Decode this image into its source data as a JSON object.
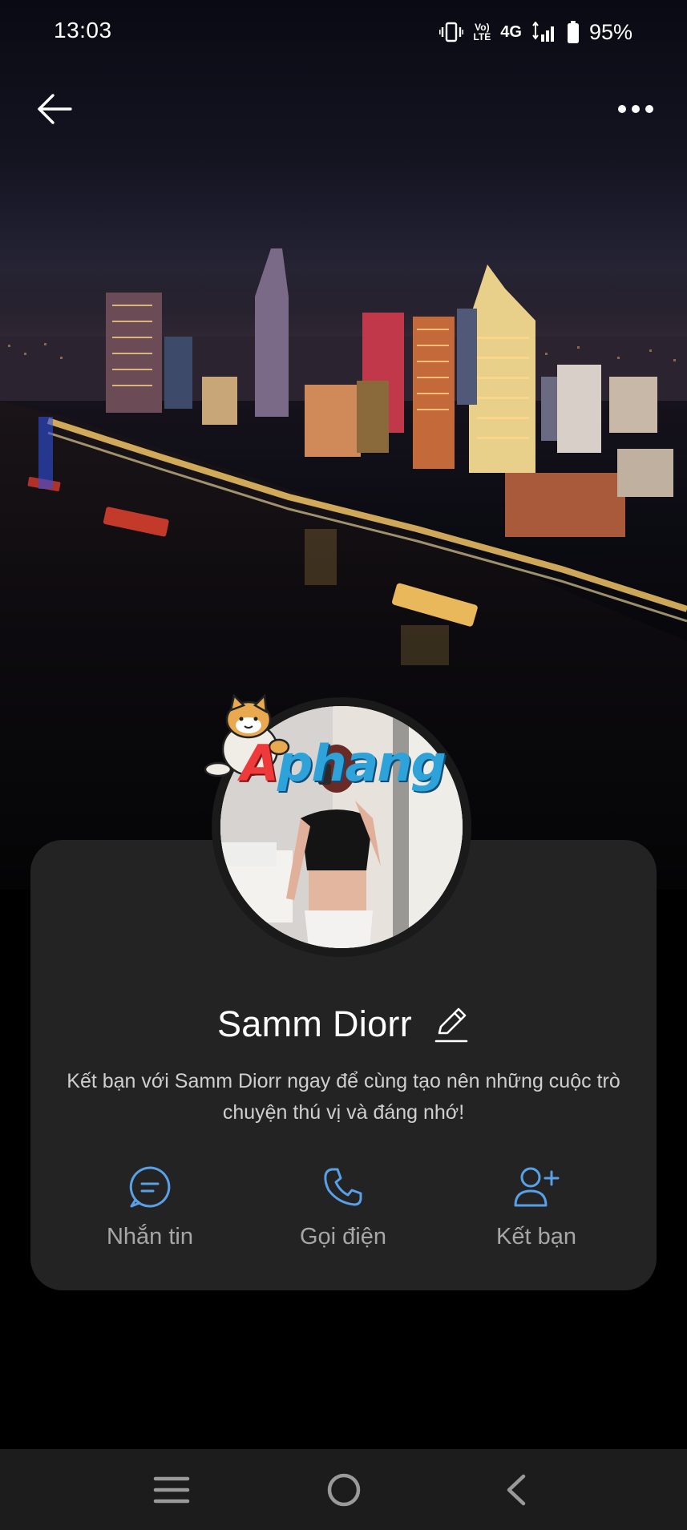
{
  "status_bar": {
    "time": "13:03",
    "volte_top": "Vo)",
    "volte_bottom": "LTE",
    "network": "4G",
    "battery_percent": "95%",
    "battery_level": 0.95
  },
  "top_nav": {
    "back_icon": "arrow-left-icon",
    "more_icon": "more-horizontal-icon"
  },
  "profile": {
    "name": "Samm Diorr",
    "description": "Kết bạn với Samm Diorr ngay để cùng tạo nên những cuộc trò chuyện thú vị và đáng nhớ!",
    "edit_icon": "pencil-icon"
  },
  "watermark": {
    "text_a": "A",
    "text_rest": "phang"
  },
  "actions": [
    {
      "label": "Nhắn tin",
      "icon": "chat-bubble-icon"
    },
    {
      "label": "Gọi điện",
      "icon": "phone-icon"
    },
    {
      "label": "Kết bạn",
      "icon": "add-friend-icon"
    }
  ],
  "colors": {
    "accent": "#5aa0e6",
    "card_bg": "#232323",
    "label_gray": "#a7a7a7",
    "nav_bg": "#1c1c1c"
  },
  "nav_bar": {
    "recent_icon": "menu-lines-icon",
    "home_icon": "circle-home-icon",
    "back_icon": "chevron-left-icon"
  }
}
